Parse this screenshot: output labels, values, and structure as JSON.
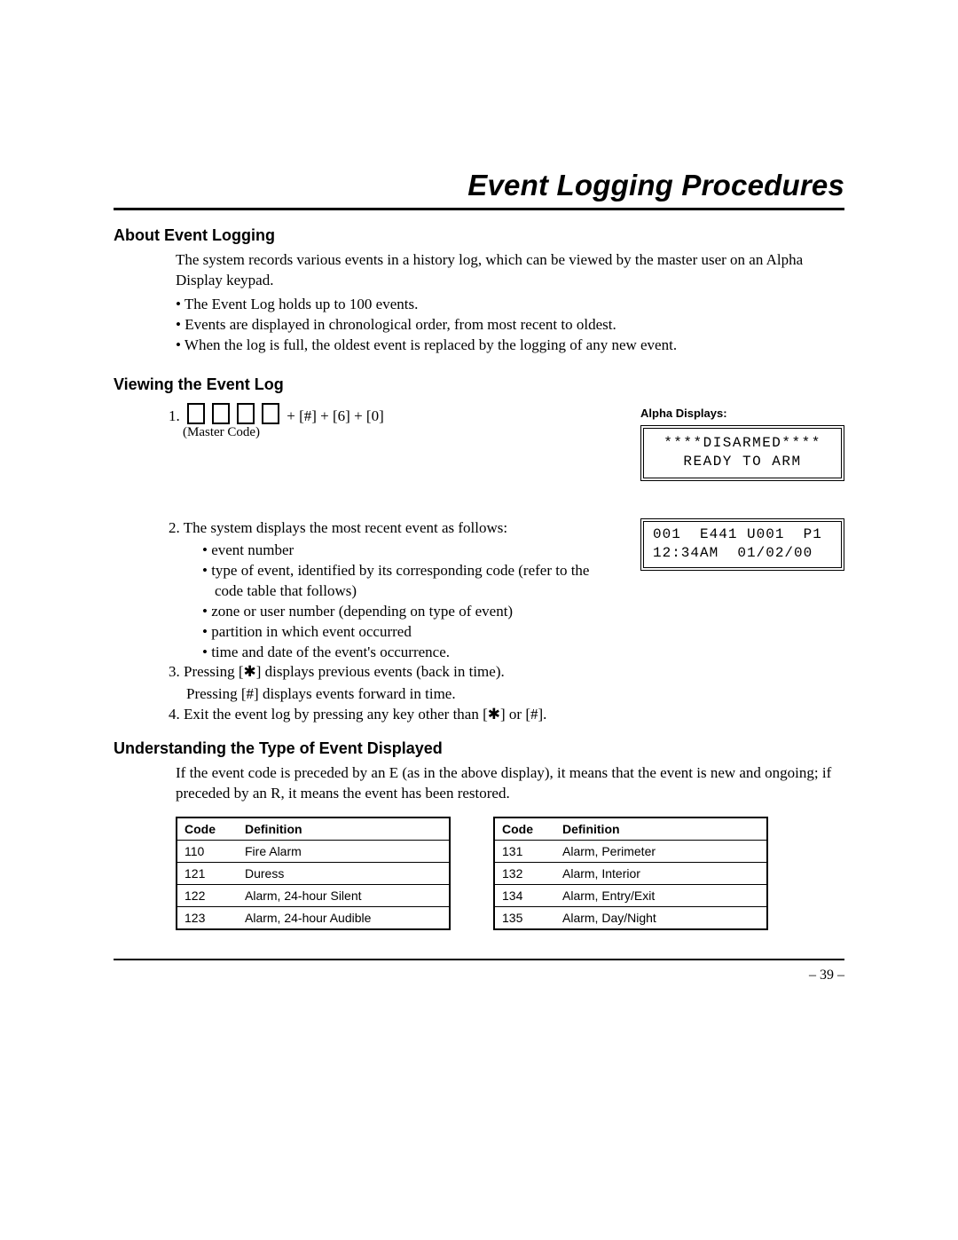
{
  "title": "Event Logging Procedures",
  "sections": {
    "about": {
      "heading": "About Event Logging",
      "intro": "The system records various events in a history log, which can be viewed by the master user on an Alpha Display keypad.",
      "bullets": [
        "• The Event Log holds up to 100 events.",
        "• Events are displayed in chronological order, from most recent to oldest.",
        "• When the log is full, the oldest event is replaced by the logging of any new event."
      ]
    },
    "viewing": {
      "heading": "Viewing the Event Log",
      "step1_num": "1.",
      "step1_tail": " +  [#] +  [6] + [0]",
      "master_code": "(Master Code)",
      "alpha_label": "Alpha Displays:",
      "lcd1": "****DISARMED****\nREADY TO ARM",
      "lcd2": "001  E441 U001  P1\n12:34AM  01/02/00",
      "step2": "2.  The system displays the most recent event as follows:",
      "step2_bullets": [
        "• event number",
        "• type of event, identified by its corresponding code (refer to the code table that follows)",
        "• zone or user number (depending on type of event)",
        "• partition in which event occurred",
        "• time and date of the event's occurrence."
      ],
      "step3a": "3.  Pressing [✱] displays previous events (back in time).",
      "step3b": "Pressing [#] displays events forward in time.",
      "step4": "4.  Exit the event log by pressing any key other than [✱] or [#]."
    },
    "understanding": {
      "heading": "Understanding the Type of Event Displayed",
      "intro": "If the event code is preceded by an E (as in the above display), it means that the event is new and ongoing; if preceded by an R, it means the event has been restored."
    }
  },
  "code_table": {
    "headers": {
      "code": "Code",
      "definition": "Definition"
    },
    "left": [
      {
        "code": "110",
        "def": "Fire Alarm"
      },
      {
        "code": "121",
        "def": "Duress"
      },
      {
        "code": "122",
        "def": "Alarm, 24-hour Silent"
      },
      {
        "code": "123",
        "def": "Alarm, 24-hour Audible"
      }
    ],
    "right": [
      {
        "code": "131",
        "def": "Alarm, Perimeter"
      },
      {
        "code": "132",
        "def": "Alarm, Interior"
      },
      {
        "code": "134",
        "def": "Alarm, Entry/Exit"
      },
      {
        "code": "135",
        "def": "Alarm, Day/Night"
      }
    ]
  },
  "page_number": "– 39 –"
}
